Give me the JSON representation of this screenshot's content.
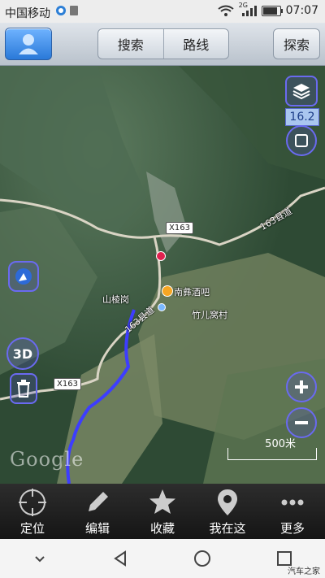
{
  "status_bar": {
    "carrier": "中国移动",
    "signal_label": "2G",
    "time": "07:07"
  },
  "top_bar": {
    "search_label": "搜索",
    "route_label": "路线",
    "explore_label": "探索"
  },
  "map": {
    "zoom_level": "16.2",
    "watermark": "Google",
    "scale_label": "500米",
    "labels": {
      "road_x163_top": "X163",
      "road_163_upper": "163县道",
      "poi_restaurant": "南彝酒吧",
      "village_shanling": "山棱岗",
      "village_zhuer": "竹儿窝村",
      "road_163_lower": "163县道",
      "road_x163_bottom": "X163"
    }
  },
  "toolbar": {
    "locate": "定位",
    "edit": "编辑",
    "favorites": "收藏",
    "where_am_i": "我在这",
    "more": "更多"
  },
  "watermark_corner": "汽车之家"
}
